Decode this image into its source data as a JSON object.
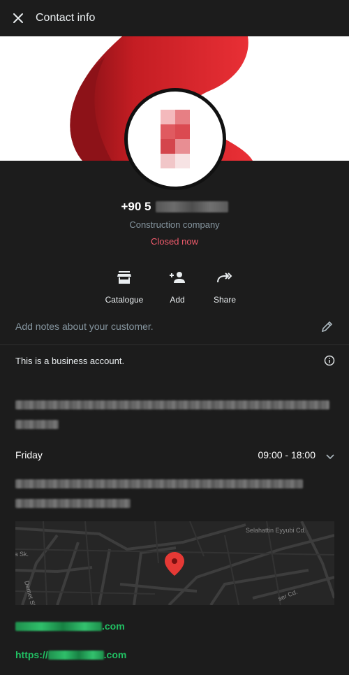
{
  "header": {
    "title": "Contact info",
    "close_icon": "close-icon"
  },
  "profile": {
    "phone_prefix": "+90 5",
    "category": "Construction company",
    "status": "Closed now",
    "status_color": "#f15c6d",
    "brand_red": "#e8272c"
  },
  "actions": [
    {
      "label": "Catalogue",
      "icon": "storefront-icon"
    },
    {
      "label": "Add",
      "icon": "add-person-icon"
    },
    {
      "label": "Share",
      "icon": "share-icon"
    }
  ],
  "notes": {
    "placeholder": "Add notes about your customer.",
    "icon": "pencil-icon"
  },
  "business": {
    "label": "This is a business account.",
    "icon": "info-icon"
  },
  "hours": {
    "day": "Friday",
    "time": "09:00 - 18:00",
    "icon": "chevron-down-icon"
  },
  "map": {
    "street_1": "Selahattin Eyyubi Cd.",
    "street_2": "sa Sk.",
    "street_3": "Demet Sk.",
    "street_4": "ser Cd.",
    "pin_color": "#e53935"
  },
  "links": {
    "email_suffix": ".com",
    "website_prefix": "https://",
    "website_suffix": ".com",
    "link_color": "#21c063"
  }
}
